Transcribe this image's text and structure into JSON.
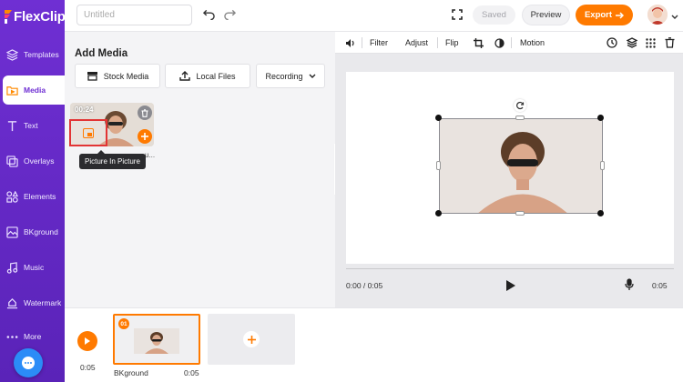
{
  "app": {
    "logo_text": "FlexClip",
    "accent": "#ff7a00",
    "sidebar_color": "#6f2fd3"
  },
  "sidebar": {
    "items": [
      {
        "label": "Templates",
        "icon": "layers-icon"
      },
      {
        "label": "Media",
        "icon": "media-icon",
        "active": true
      },
      {
        "label": "Text",
        "icon": "text-icon"
      },
      {
        "label": "Overlays",
        "icon": "overlays-icon"
      },
      {
        "label": "Elements",
        "icon": "elements-icon"
      },
      {
        "label": "BKground",
        "icon": "background-icon"
      },
      {
        "label": "Music",
        "icon": "music-icon"
      },
      {
        "label": "Watermark",
        "icon": "watermark-icon"
      },
      {
        "label": "More",
        "icon": "more-icon"
      }
    ]
  },
  "topbar": {
    "title_placeholder": "Untitled",
    "saved_label": "Saved",
    "preview_label": "Preview",
    "export_label": "Export"
  },
  "media_panel": {
    "title": "Add Media",
    "stock_label": "Stock Media",
    "local_label": "Local Files",
    "recording_label": "Recording",
    "thumb_duration": "00:24",
    "thumb_filename": "u...",
    "tooltip": "Picture In Picture"
  },
  "edit_toolbar": {
    "filter": "Filter",
    "adjust": "Adjust",
    "flip": "Flip",
    "motion": "Motion"
  },
  "player": {
    "current_time": "0:00 / 0:05",
    "duration": "0:05"
  },
  "timeline": {
    "time": "0:05",
    "clip_number": "01",
    "clip_name": "BKground",
    "clip_duration": "0:05"
  }
}
